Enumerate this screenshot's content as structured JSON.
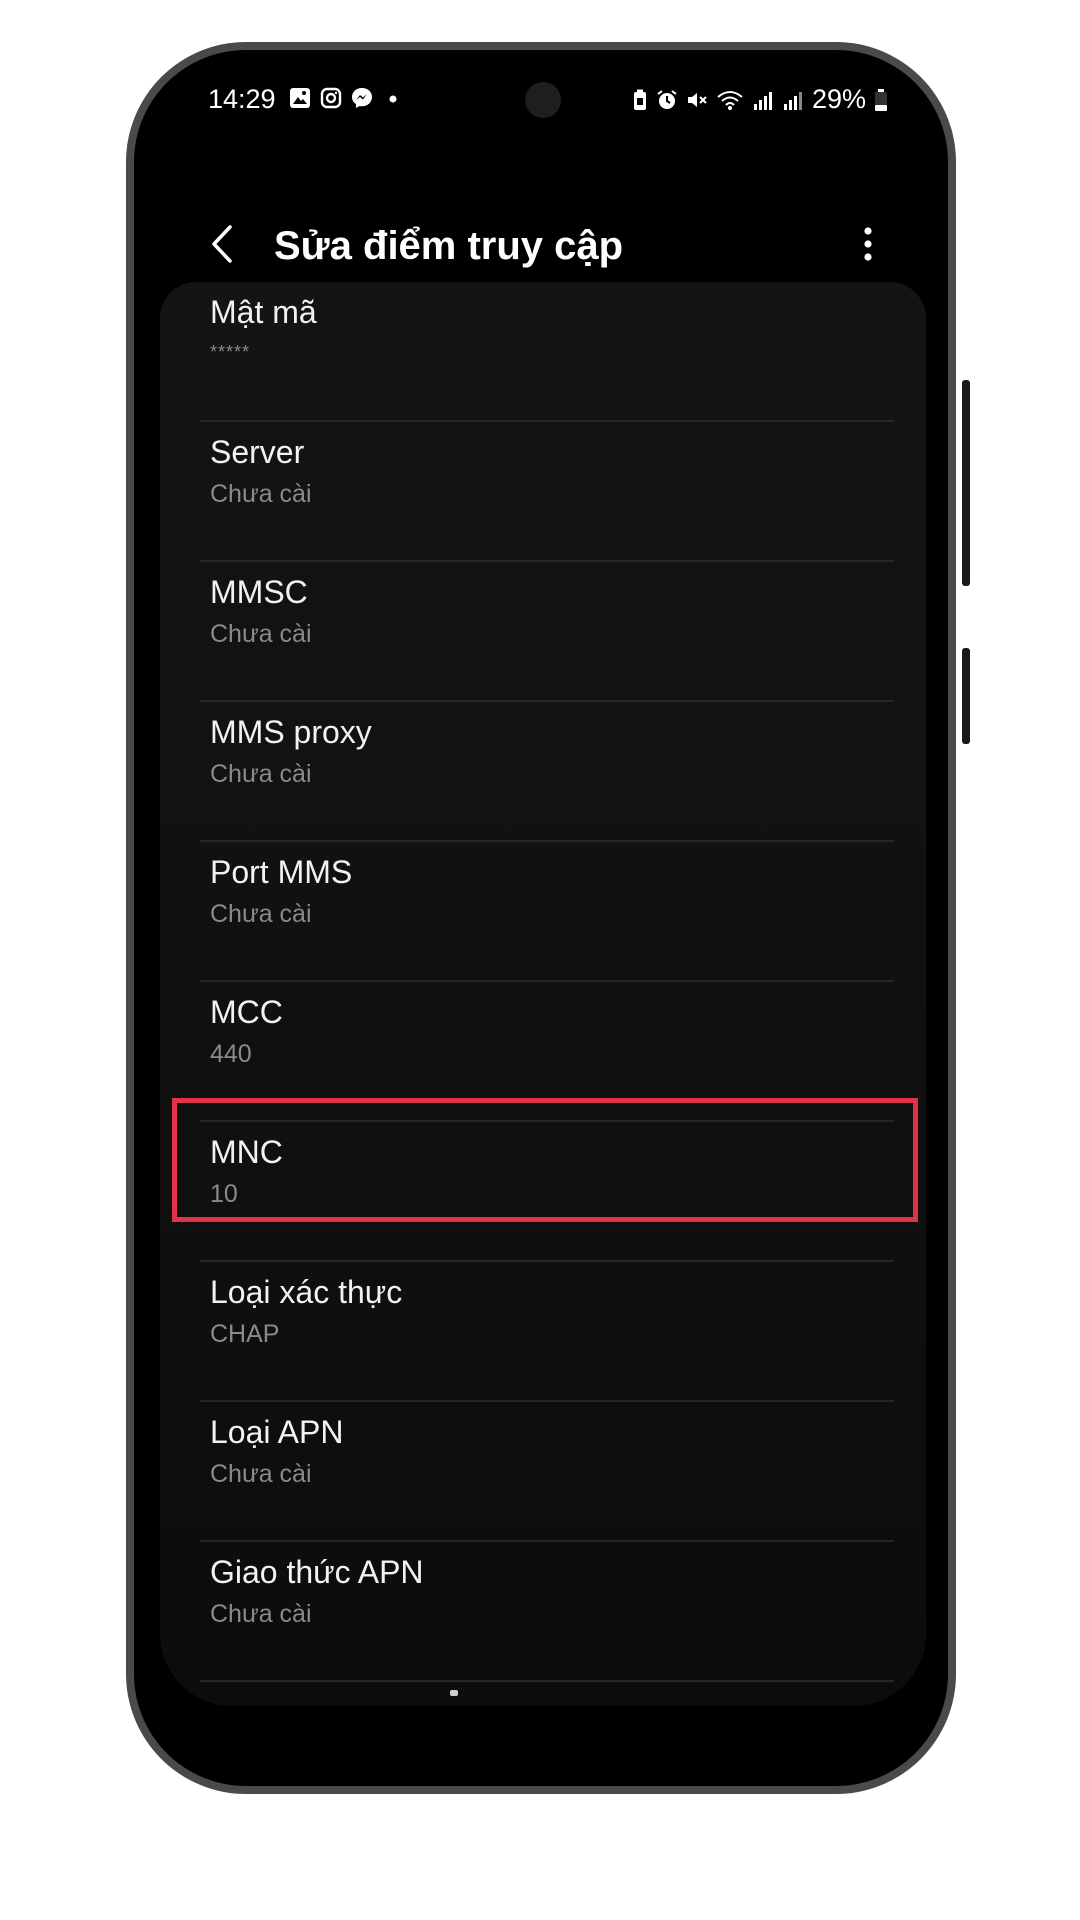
{
  "status_bar": {
    "time": "14:29",
    "notification_icons": [
      "gallery-icon",
      "instagram-icon",
      "messenger-icon",
      "dot-icon"
    ],
    "right_icons": [
      "battery-saver-icon",
      "alarm-icon",
      "mute-icon",
      "wifi-icon",
      "signal-sim1-icon",
      "signal-sim2-icon"
    ],
    "battery": "29%"
  },
  "header": {
    "title": "Sửa điểm truy cập",
    "back_icon": "back-arrow-icon",
    "more_icon": "more-vertical-icon"
  },
  "settings": [
    {
      "title": "Mật mã",
      "value": "*****"
    },
    {
      "title": "Server",
      "value": "Chưa cài"
    },
    {
      "title": "MMSC",
      "value": "Chưa cài"
    },
    {
      "title": "MMS proxy",
      "value": "Chưa cài"
    },
    {
      "title": "Port MMS",
      "value": "Chưa cài"
    },
    {
      "title": "MCC",
      "value": "440"
    },
    {
      "title": "MNC",
      "value": "10"
    },
    {
      "title": "Loại xác thực",
      "value": "CHAP",
      "highlighted": true
    },
    {
      "title": "Loại APN",
      "value": "Chưa cài"
    },
    {
      "title": "Giao thức APN",
      "value": "Chưa cài"
    }
  ],
  "colors": {
    "highlight": "#e0334b",
    "background": "#000000",
    "text_primary": "#f2f2f2",
    "text_secondary": "#8a8a8a"
  }
}
